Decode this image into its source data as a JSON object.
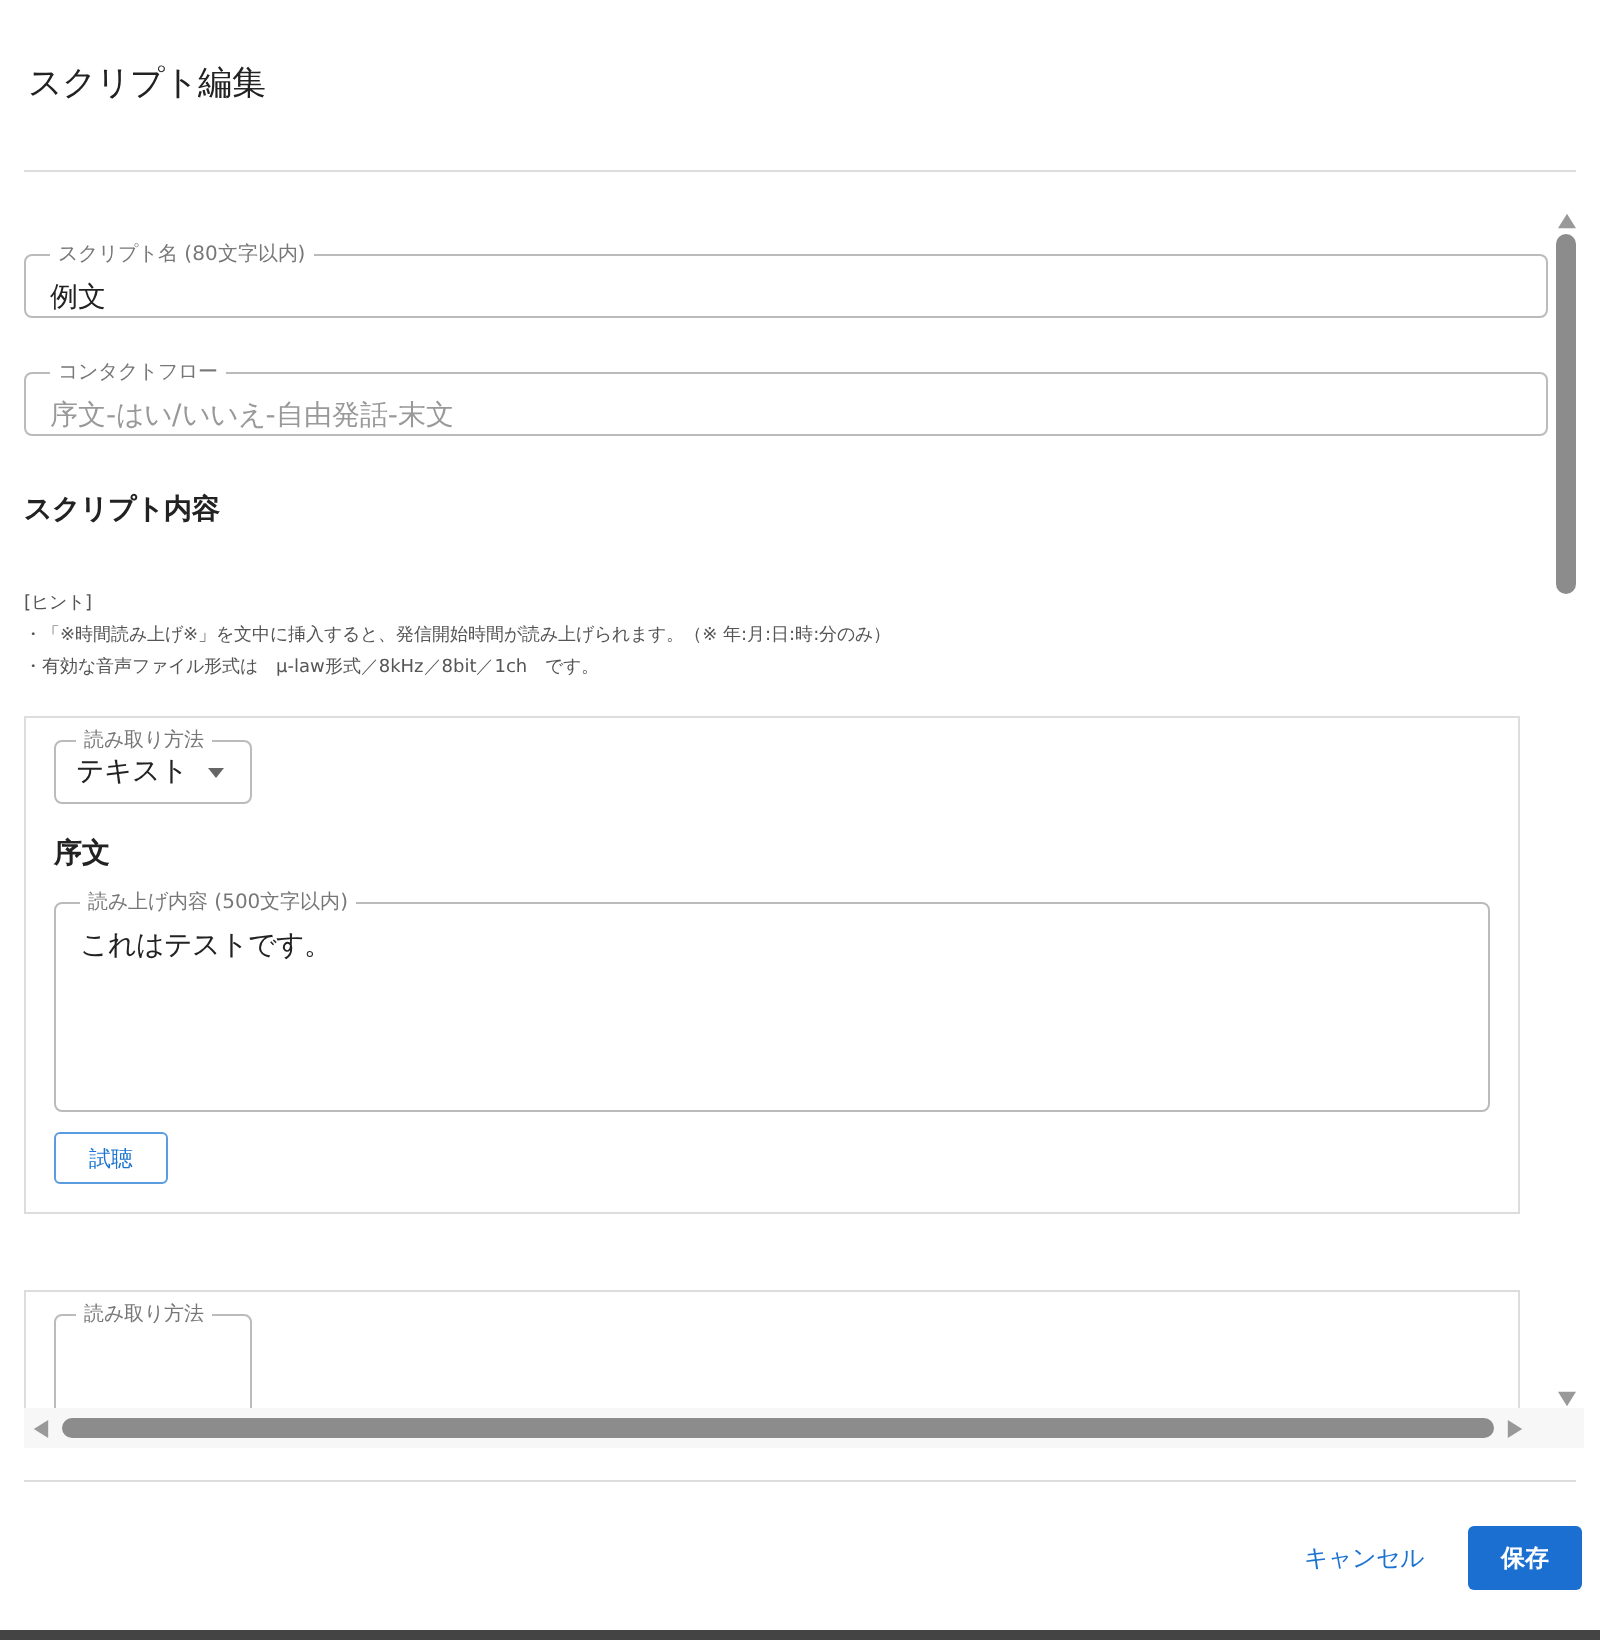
{
  "dialog": {
    "title": "スクリプト編集"
  },
  "script_name": {
    "label": "スクリプト名 (80文字以内)",
    "value": "例文"
  },
  "contact_flow": {
    "label": "コンタクトフロー",
    "placeholder": "序文-はい/いいえ-自由発話-末文"
  },
  "section_title": "スクリプト内容",
  "hint": {
    "title": "[ヒント]",
    "lines": [
      "・「※時間読み上げ※」を文中に挿入すると、発信開始時間が読み上げられます。（※ 年:月:日:時:分のみ）",
      "・有効な音声ファイル形式は　µ-law形式／8kHz／8bit／1ch　です。"
    ]
  },
  "cards": [
    {
      "read_method": {
        "label": "読み取り方法",
        "value": "テキスト"
      },
      "heading": "序文",
      "content": {
        "label": "読み上げ内容 (500文字以内)",
        "value": "これはテストです。"
      },
      "button": "試聴"
    },
    {
      "read_method": {
        "label": "読み取り方法"
      }
    }
  ],
  "footer": {
    "cancel": "キャンセル",
    "save": "保存"
  }
}
